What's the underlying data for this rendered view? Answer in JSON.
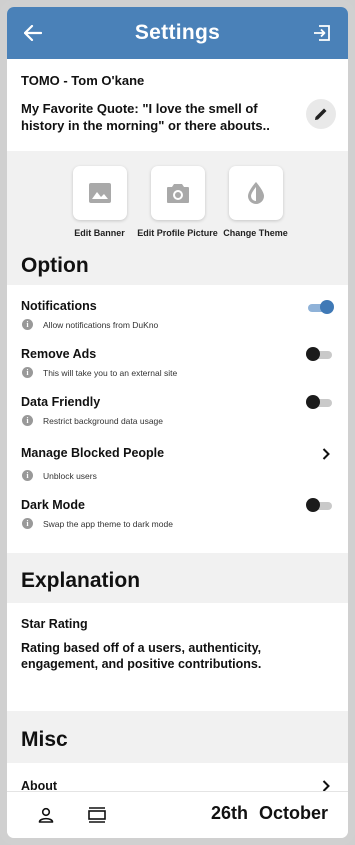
{
  "header": {
    "title": "Settings",
    "back_icon": "arrow-left-icon",
    "logout_icon": "logout-icon",
    "color": "#4a81b8"
  },
  "profile": {
    "name": "TOMO - Tom O'kane",
    "quote": "My Favorite Quote: \"I love the smell of history in the morning\" or there abouts..",
    "edit_icon": "pencil-icon"
  },
  "actions": [
    {
      "label": "Edit Banner",
      "icon": "image-icon"
    },
    {
      "label": "Edit Profile Picture",
      "icon": "camera-icon"
    },
    {
      "label": "Change Theme",
      "icon": "drop-icon"
    }
  ],
  "option": {
    "title": "Option",
    "items": [
      {
        "title": "Notifications",
        "subtitle": "Allow notifications from DuKno",
        "control": "toggle",
        "on": true
      },
      {
        "title": "Remove Ads",
        "subtitle": "This will take you to an external site",
        "control": "toggle",
        "on": false
      },
      {
        "title": "Data Friendly",
        "subtitle": "Restrict background data usage",
        "control": "toggle",
        "on": false
      },
      {
        "title": "Manage Blocked People",
        "subtitle": "Unblock users",
        "control": "chevron"
      },
      {
        "title": "Dark Mode",
        "subtitle": "Swap the app theme to dark mode",
        "control": "toggle",
        "on": false
      }
    ]
  },
  "explanation": {
    "title": "Explanation",
    "item_title": "Star Rating",
    "item_text": "Rating based off of a users, authenticity, engagement, and positive contributions."
  },
  "misc": {
    "title": "Misc",
    "about_label": "About"
  },
  "bottom_bar": {
    "date": "26th October",
    "profile_icon": "person-icon",
    "feed_icon": "feed-icon"
  }
}
